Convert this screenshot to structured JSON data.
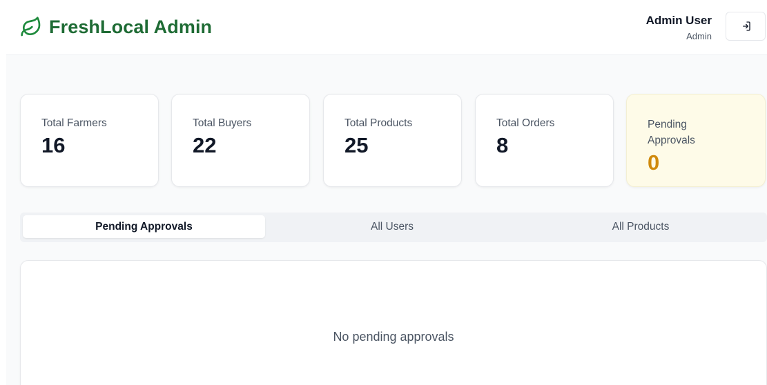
{
  "header": {
    "brand_title": "FreshLocal Admin",
    "brand_icon": "leaf-icon",
    "brand_color": "#1e6b34",
    "user_name": "Admin User",
    "user_role": "Admin",
    "logout_icon": "logout-icon"
  },
  "stats": [
    {
      "label": "Total Farmers",
      "value": "16"
    },
    {
      "label": "Total Buyers",
      "value": "22"
    },
    {
      "label": "Total Products",
      "value": "25"
    },
    {
      "label": "Total Orders",
      "value": "8"
    },
    {
      "label": "Pending Approvals",
      "value": "0",
      "accent": "#d08a0c"
    }
  ],
  "tabs": [
    {
      "label": "Pending Approvals",
      "active": true
    },
    {
      "label": "All Users",
      "active": false
    },
    {
      "label": "All Products",
      "active": false
    }
  ],
  "panel": {
    "empty_message": "No pending approvals"
  }
}
